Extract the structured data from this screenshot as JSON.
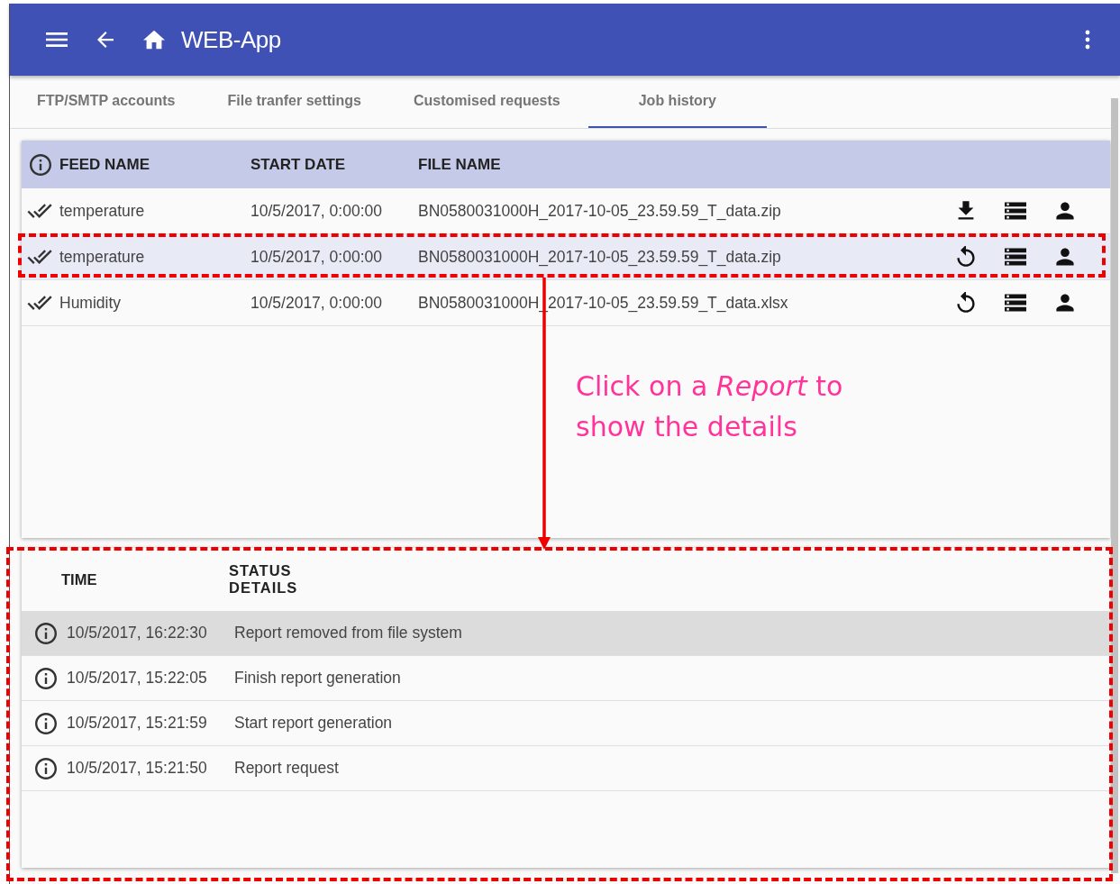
{
  "app_bar": {
    "title": "WEB-App"
  },
  "tabs": [
    {
      "label": "FTP/SMTP accounts",
      "selected": false
    },
    {
      "label": "File tranfer settings",
      "selected": false
    },
    {
      "label": "Customised requests",
      "selected": false
    },
    {
      "label": "Job history",
      "selected": true
    }
  ],
  "jobs_table": {
    "columns": [
      "FEED NAME",
      "START DATE",
      "FILE NAME"
    ],
    "rows": [
      {
        "feed_name": "temperature",
        "start_date": "10/5/2017, 0:00:00",
        "file_name": "BN0580031000H_2017-10-05_23.59.59_T_data.zip",
        "actions": [
          {
            "kind": "download"
          },
          {
            "kind": "list"
          },
          {
            "kind": "person"
          }
        ],
        "selected": false
      },
      {
        "feed_name": "temperature",
        "start_date": "10/5/2017, 0:00:00",
        "file_name": "BN0580031000H_2017-10-05_23.59.59_T_data.zip",
        "actions": [
          {
            "kind": "replay"
          },
          {
            "kind": "list"
          },
          {
            "kind": "person"
          }
        ],
        "selected": true
      },
      {
        "feed_name": "Humidity",
        "start_date": "10/5/2017, 0:00:00",
        "file_name": "BN0580031000H_2017-10-05_23.59.59_T_data.xlsx",
        "actions": [
          {
            "kind": "replay"
          },
          {
            "kind": "list"
          },
          {
            "kind": "person"
          }
        ],
        "selected": false
      }
    ]
  },
  "details_table": {
    "columns": [
      "TIME",
      "STATUS DETAILS"
    ],
    "rows": [
      {
        "time": "10/5/2017, 16:22:30",
        "status": "Report removed from file system",
        "selected": true
      },
      {
        "time": "10/5/2017, 15:22:05",
        "status": "Finish report generation",
        "selected": false
      },
      {
        "time": "10/5/2017, 15:21:59",
        "status": "Start report generation",
        "selected": false
      },
      {
        "time": "10/5/2017, 15:21:50",
        "status": "Report request",
        "selected": false
      }
    ]
  },
  "annotation": {
    "callout": "Click on a *Report* to show the details"
  }
}
